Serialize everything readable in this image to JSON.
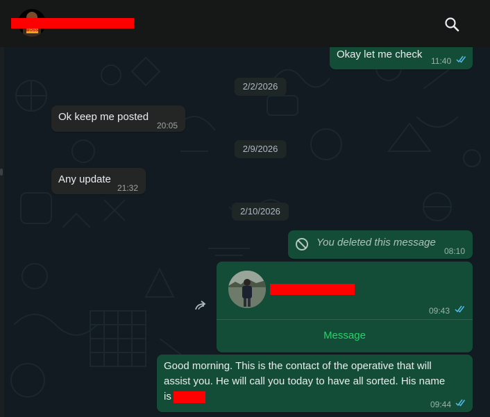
{
  "header": {
    "contact_name": ""
  },
  "colors": {
    "incoming_bubble": "#242626",
    "outgoing_bubble": "#144d37",
    "accent": "#25d366",
    "read_ticks": "#53bdeb",
    "redaction": "#ff0000"
  },
  "messages": [
    {
      "text": "Okay let me check",
      "time": "11:40"
    },
    {
      "date": "2/2/2026"
    },
    {
      "text": "Ok keep me posted",
      "time": "20:05"
    },
    {
      "date": "2/9/2026"
    },
    {
      "text": "Any update",
      "time": "21:32"
    },
    {
      "date": "2/10/2026"
    },
    {
      "text": "You deleted this message",
      "time": "08:10"
    },
    {
      "contact_card_time": "09:43",
      "button": "Message"
    },
    {
      "text_line1": "Good morning. This is the contact of the operative that will",
      "text_line2": "assist you. He will call you today to have all sorted. His name",
      "text_line3": "is",
      "time": "09:44"
    }
  ],
  "icons": {
    "search": "search-icon",
    "forward": "forward-icon",
    "deleted": "block-icon",
    "read": "double-check-icon"
  }
}
